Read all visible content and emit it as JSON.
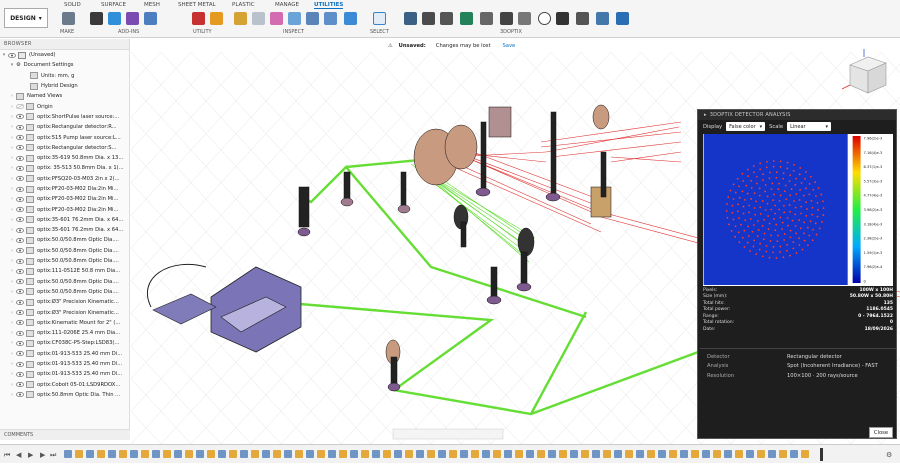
{
  "toolbar": {
    "workspace_label": "DESIGN",
    "tabs": [
      "SOLID",
      "SURFACE",
      "MESH",
      "SHEET METAL",
      "PLASTIC",
      "MANAGE",
      "UTILITIES"
    ],
    "active_tab": "UTILITIES",
    "groups": [
      "MAKE",
      "ADD-INS",
      "UTILITY",
      "INSPECT",
      "SELECT",
      "3DOPTIX"
    ]
  },
  "status_bar": {
    "unsaved_label": "Unsaved:",
    "message": "Changes may be lost",
    "save_label": "Save"
  },
  "browser": {
    "title": "BROWSER",
    "root": "(Unsaved)",
    "doc_settings": "Document Settings",
    "units": "Units: mm, g",
    "hybrid": "Hybrid Design",
    "named_views": "Named Views",
    "origin": "Origin",
    "items": [
      "optix:ShortPulse laser source:...",
      "optix:Rectangular detector:R...",
      "optix:515 Pump laser source:L...",
      "optix:Rectangular detector:S...",
      "optix:35-619 50.8mm Dia. x 13...",
      "optix: 35-513 50.8mm Dia. x 1(...",
      "optix:PFSQ20-03-M03 2in x 2(...",
      "optix:PF20-03-M02 Dia:2in Mi...",
      "optix:PF20-03-M02 Dia:2in Mi...",
      "optix:PF20-03-M02 Dia:2in Mi...",
      "optix:35-601 76.2mm Dia. x 64...",
      "optix:35-601 76.2mm Dia. x 64...",
      "optix:50.0/50.8mm Optic Dia....",
      "optix:50.0/50.8mm Optic Dia....",
      "optix:50.0/50.8mm Optic Dia....",
      "optix:111-0512E 50.8 mm Dia...",
      "optix:50.0/50.8mm Optic Dia....",
      "optix:50.0/50.8mm Optic Dia....",
      "optix:Ø3\" Precision Kinematic...",
      "optix:Ø3\" Precision Kinematic...",
      "optix:Kinematic Mount for 2\" (...",
      "optix:111-0206E 25.4 mm Dia...",
      "optix:CF038C-P5-Step:LSD83(...",
      "optix:01-913-533 25.40 mm Di...",
      "optix:01-913-533 25.40 mm Di...",
      "optix:01-913-533 25.40 mm Di...",
      "optix:Coboit 05-01:LSD9RDOX...",
      "optix:50.8mm Optic Dia. Thin ..."
    ],
    "comments": "COMMENTS"
  },
  "panel": {
    "title": "3DOPTIX DETECTOR ANALYSIS",
    "display_label": "Display",
    "display_value": "False color",
    "scale_label": "Scale",
    "scale_value": "Linear",
    "colorbar_ticks": [
      "7.96(2)e-3",
      "7.16(4)e-3",
      "6.37(1)e-3",
      "5.57(3)e-3",
      "4.77(4)e-3",
      "3.98(2)e-3",
      "3.18(4)e-3",
      "2.38(2)e-3",
      "1.59(1)e-3",
      "7.96(2)e-4",
      "0"
    ],
    "stats": [
      {
        "k": "Pixels:",
        "v": "100W x 100H"
      },
      {
        "k": "Size (mm):",
        "v": "50.80W x 50.80H"
      },
      {
        "k": "Total hits:",
        "v": "135"
      },
      {
        "k": "Total power:",
        "v": "1186.0545"
      },
      {
        "k": "Range:",
        "v": "0 - 7964.1522"
      },
      {
        "k": "Total rotation:",
        "v": "0"
      },
      {
        "k": "Date:",
        "v": "18/09/2026"
      }
    ],
    "info": [
      {
        "k": "Detector",
        "v": "Rectangular detector"
      },
      {
        "k": "Analysis",
        "v": "Spot (Incoherent Irradiance) - FAST"
      },
      {
        "k": "Resolution",
        "v": "100×100 · 200 rays/source"
      }
    ],
    "close_label": "Close"
  },
  "colors": {
    "accent": "#0a6fc2",
    "beam_green": "#5ddc2a",
    "beam_red": "#e23030",
    "panel_bg": "#1e1e1e"
  }
}
